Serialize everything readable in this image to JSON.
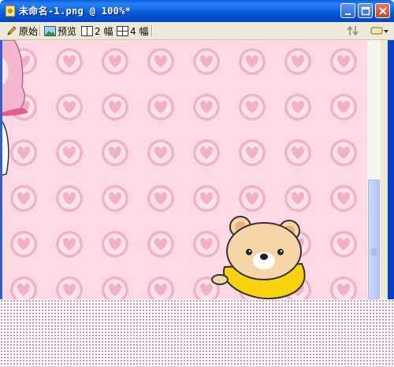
{
  "window": {
    "title": "未命名-1.png @ 100%*",
    "controls": [
      "minimize",
      "maximize",
      "close"
    ]
  },
  "toolbar": {
    "original_label": "原始",
    "preview_label": "预览",
    "two_up_label": "2 幅",
    "four_up_label": "4 幅"
  },
  "canvas": {
    "background": "#fcd9e3",
    "pattern": "heart-circles",
    "heart_color": "#f7b7cb"
  },
  "colors": {
    "titlebar": "#0558d8",
    "toolbar": "#ece9d8",
    "bear_fur": "#f6d6a8",
    "bear_shirt": "#f7d30d"
  }
}
